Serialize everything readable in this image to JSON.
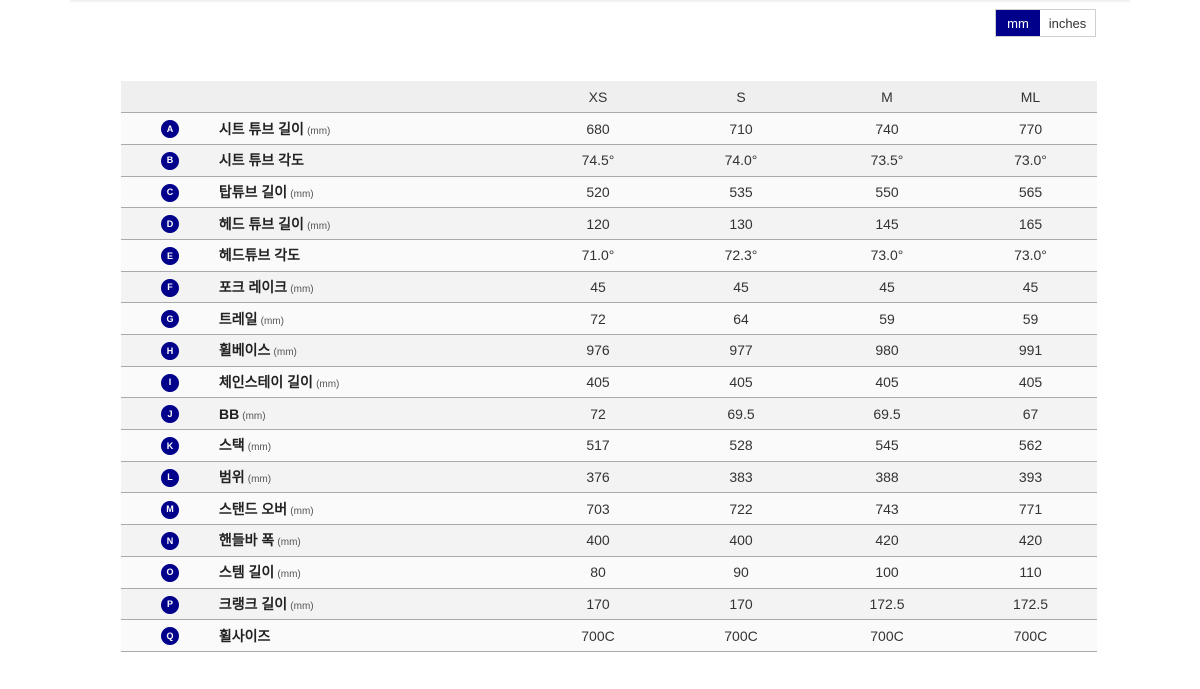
{
  "unit_toggle": {
    "mm_label": "mm",
    "inches_label": "inches",
    "active": "mm"
  },
  "sizes": [
    "XS",
    "S",
    "M",
    "ML"
  ],
  "colors": {
    "accent": "#00008b",
    "header_bg": "#efefef",
    "row_border": "#aaaaaa"
  },
  "rows": [
    {
      "letter": "A",
      "label": "시트 튜브 길이",
      "unit": "(mm)",
      "values": [
        "680",
        "710",
        "740",
        "770"
      ]
    },
    {
      "letter": "B",
      "label": "시트 튜브 각도",
      "unit": "",
      "values": [
        "74.5°",
        "74.0°",
        "73.5°",
        "73.0°"
      ]
    },
    {
      "letter": "C",
      "label": "탑튜브 길이",
      "unit": "(mm)",
      "values": [
        "520",
        "535",
        "550",
        "565"
      ]
    },
    {
      "letter": "D",
      "label": "헤드 튜브 길이",
      "unit": "(mm)",
      "values": [
        "120",
        "130",
        "145",
        "165"
      ]
    },
    {
      "letter": "E",
      "label": "헤드튜브 각도",
      "unit": "",
      "values": [
        "71.0°",
        "72.3°",
        "73.0°",
        "73.0°"
      ]
    },
    {
      "letter": "F",
      "label": "포크 레이크",
      "unit": "(mm)",
      "values": [
        "45",
        "45",
        "45",
        "45"
      ]
    },
    {
      "letter": "G",
      "label": "트레일",
      "unit": "(mm)",
      "values": [
        "72",
        "64",
        "59",
        "59"
      ]
    },
    {
      "letter": "H",
      "label": "휠베이스",
      "unit": "(mm)",
      "values": [
        "976",
        "977",
        "980",
        "991"
      ]
    },
    {
      "letter": "I",
      "label": "체인스테이 길이",
      "unit": "(mm)",
      "values": [
        "405",
        "405",
        "405",
        "405"
      ]
    },
    {
      "letter": "J",
      "label": "BB",
      "unit": "(mm)",
      "values": [
        "72",
        "69.5",
        "69.5",
        "67"
      ]
    },
    {
      "letter": "K",
      "label": "스택",
      "unit": "(mm)",
      "values": [
        "517",
        "528",
        "545",
        "562"
      ]
    },
    {
      "letter": "L",
      "label": "범위",
      "unit": "(mm)",
      "values": [
        "376",
        "383",
        "388",
        "393"
      ]
    },
    {
      "letter": "M",
      "label": "스탠드 오버",
      "unit": "(mm)",
      "values": [
        "703",
        "722",
        "743",
        "771"
      ]
    },
    {
      "letter": "N",
      "label": "핸들바 폭",
      "unit": "(mm)",
      "values": [
        "400",
        "400",
        "420",
        "420"
      ]
    },
    {
      "letter": "O",
      "label": "스템 길이",
      "unit": "(mm)",
      "values": [
        "80",
        "90",
        "100",
        "110"
      ]
    },
    {
      "letter": "P",
      "label": "크랭크 길이",
      "unit": "(mm)",
      "values": [
        "170",
        "170",
        "172.5",
        "172.5"
      ]
    },
    {
      "letter": "Q",
      "label": "휠사이즈",
      "unit": "",
      "values": [
        "700C",
        "700C",
        "700C",
        "700C"
      ]
    }
  ]
}
